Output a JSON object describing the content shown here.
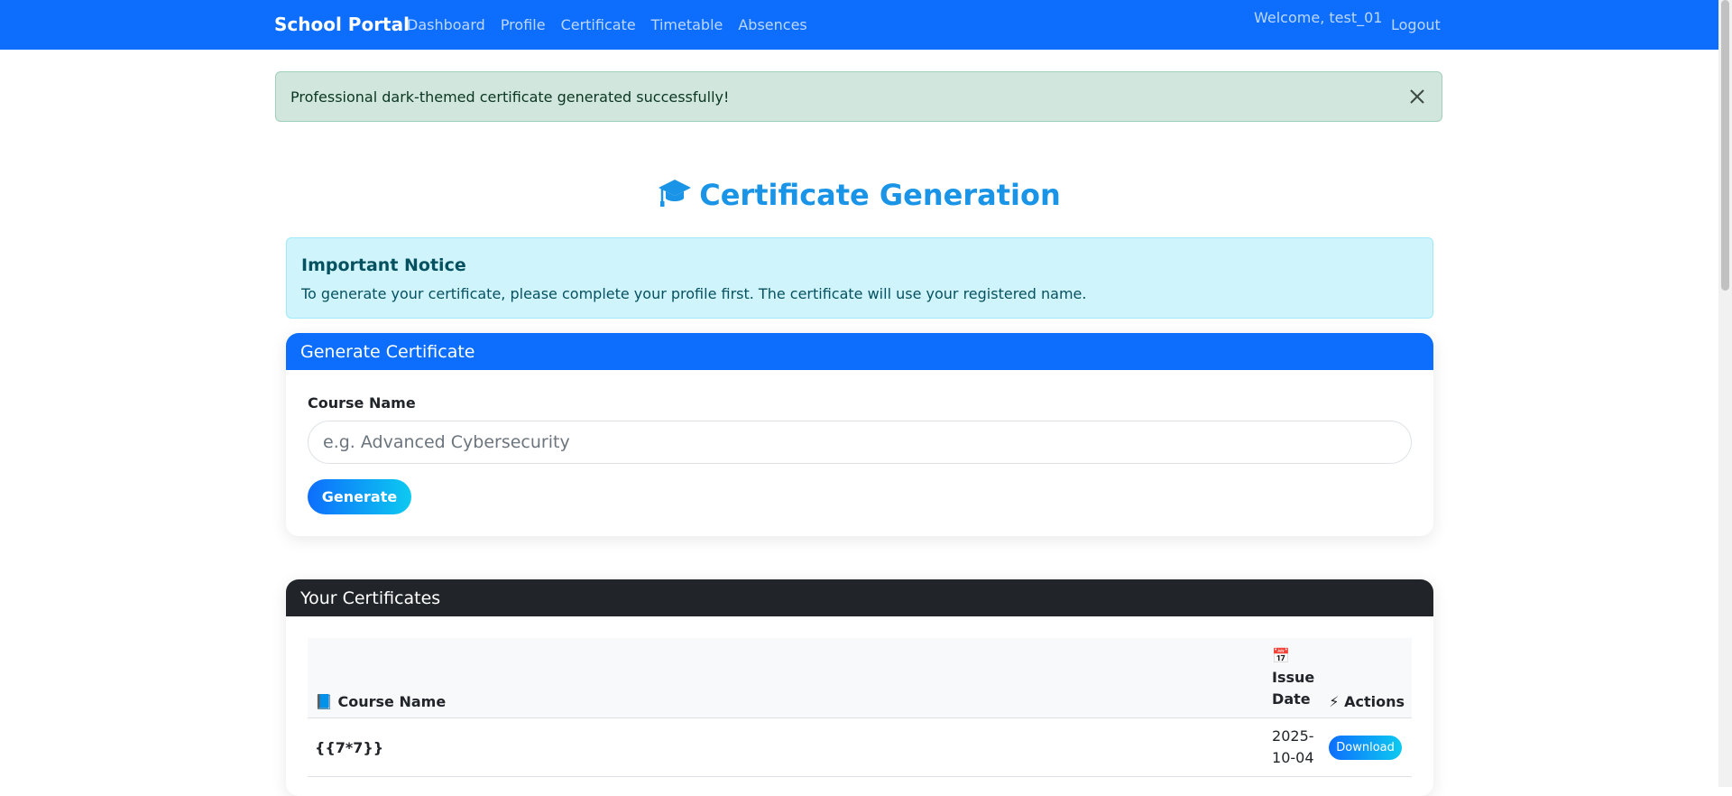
{
  "navbar": {
    "brand": "School Portal",
    "links": [
      "Dashboard",
      "Profile",
      "Certificate",
      "Timetable",
      "Absences"
    ],
    "welcome": "Welcome, test_01",
    "logout": "Logout"
  },
  "alert_success": {
    "message": "Professional dark-themed certificate generated successfully!"
  },
  "page": {
    "title": "Certificate Generation"
  },
  "notice": {
    "heading": "Important Notice",
    "text": "To generate your certificate, please complete your profile first. The certificate will use your registered name."
  },
  "generate_card": {
    "header": "Generate Certificate",
    "label": "Course Name",
    "placeholder": "e.g. Advanced Cybersecurity",
    "button": "Generate"
  },
  "certs_card": {
    "header": "Your Certificates",
    "columns": {
      "course": "📘 Course Name",
      "date_icon": "📅",
      "date_line1": "Issue",
      "date_line2": "Date",
      "actions": "⚡ Actions"
    },
    "rows": [
      {
        "course": "{{7*7}}",
        "date_line1": "2025-",
        "date_line2": "10-04",
        "action": "Download"
      }
    ]
  },
  "colors": {
    "navbar": "#0d6efd",
    "title": "#1a94e6",
    "success_bg": "#d1e7dd",
    "info_bg": "#cff4fc",
    "dark_header": "#212529"
  }
}
